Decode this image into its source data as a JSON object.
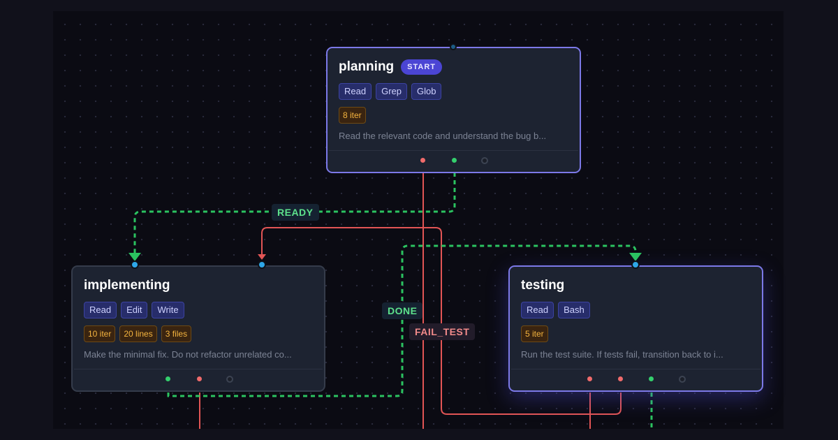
{
  "nodes": {
    "planning": {
      "title": "planning",
      "badge": "START",
      "tools": [
        "Read",
        "Grep",
        "Glob"
      ],
      "limits": [
        "8 iter"
      ],
      "description": "Read the relevant code and understand the bug b..."
    },
    "implementing": {
      "title": "implementing",
      "tools": [
        "Read",
        "Edit",
        "Write"
      ],
      "limits": [
        "10 iter",
        "20 lines",
        "3 files"
      ],
      "description": "Make the minimal fix. Do not refactor unrelated co..."
    },
    "testing": {
      "title": "testing",
      "tools": [
        "Read",
        "Bash"
      ],
      "limits": [
        "5 iter"
      ],
      "description": "Run the test suite. If tests fail, transition back to i..."
    }
  },
  "edges": {
    "ready": "READY",
    "done": "DONE",
    "fail_test": "FAIL_TEST"
  },
  "colors": {
    "success": "#34cf6d",
    "failure": "#f06b6b",
    "accent": "#7c79e8",
    "tool_chip": "#272d6a",
    "limit_chip": "#f5b43f"
  }
}
